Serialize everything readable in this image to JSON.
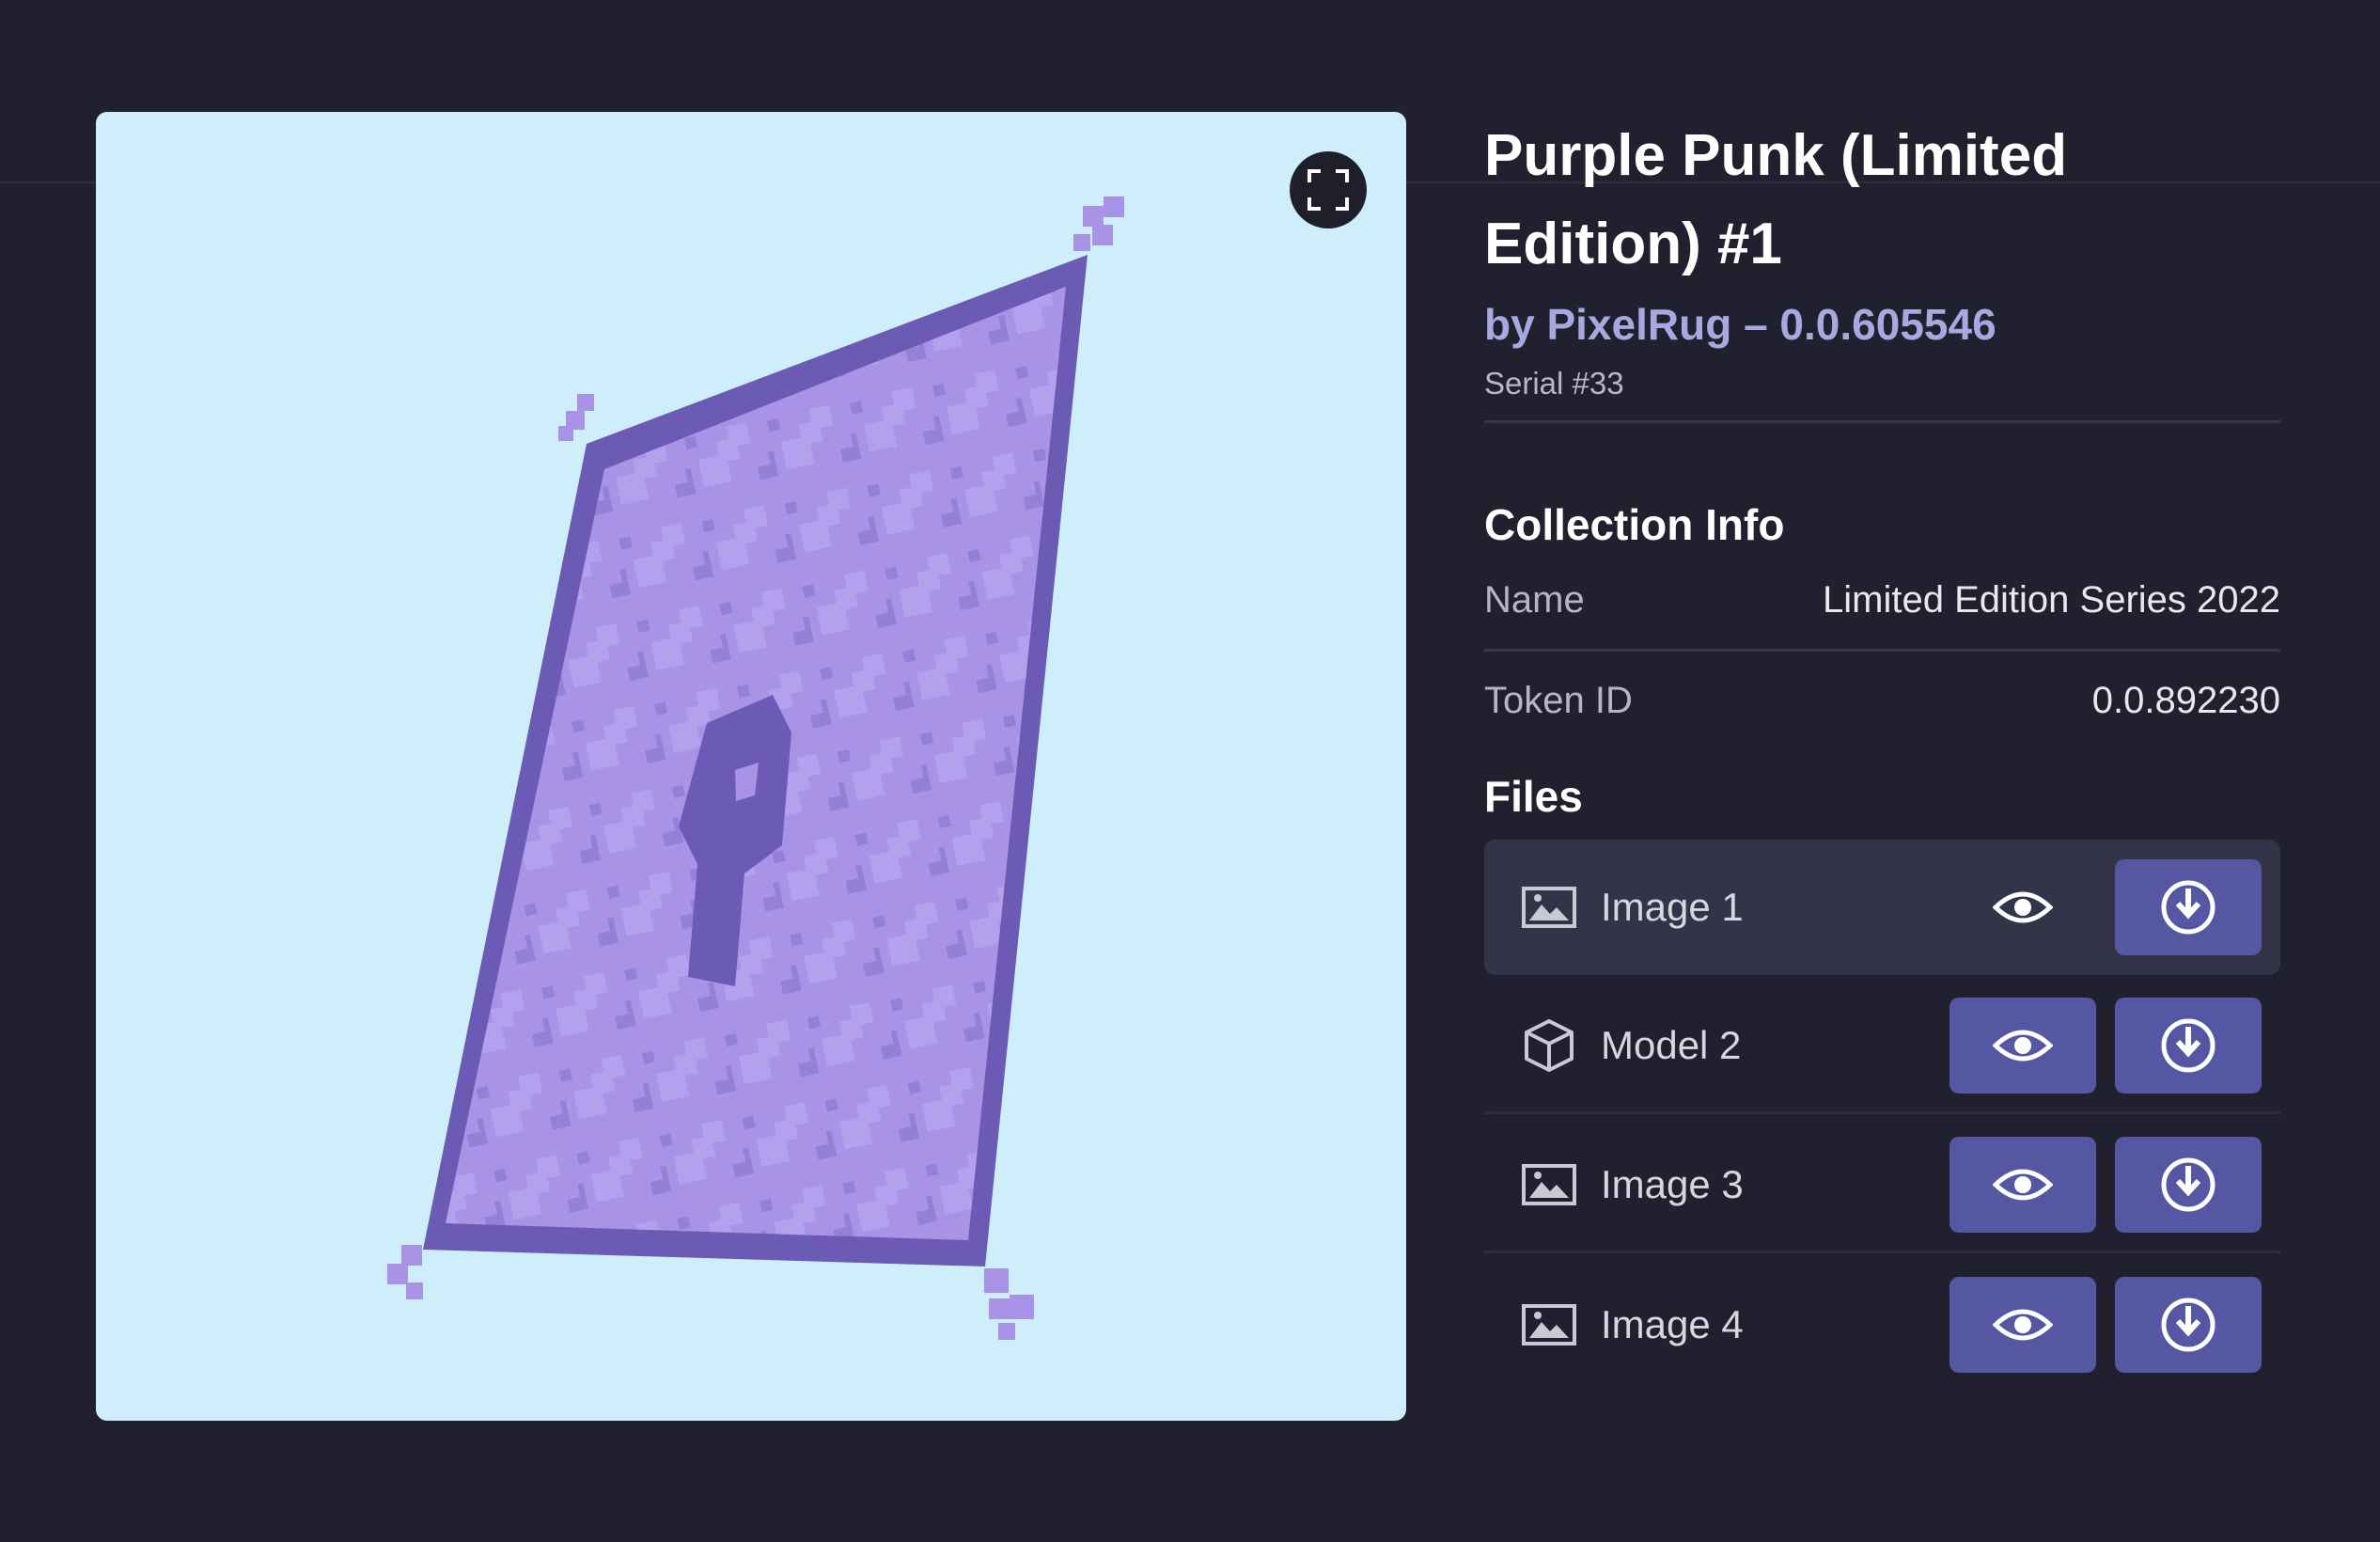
{
  "item": {
    "title": "Purple Punk (Limited Edition) #1",
    "byline": "by PixelRug – 0.0.605546",
    "serial": "Serial #33"
  },
  "collection": {
    "heading": "Collection Info",
    "rows": [
      {
        "label": "Name",
        "value": "Limited Edition Series 2022"
      },
      {
        "label": "Token ID",
        "value": "0.0.892230"
      }
    ]
  },
  "files": {
    "heading": "Files",
    "items": [
      {
        "name": "Image 1",
        "icon": "image-icon",
        "selected": true
      },
      {
        "name": "Model 2",
        "icon": "cube-icon",
        "selected": false
      },
      {
        "name": "Image 3",
        "icon": "image-icon",
        "selected": false
      },
      {
        "name": "Image 4",
        "icon": "image-icon",
        "selected": false
      }
    ]
  },
  "viewer": {
    "background": "#cfeefb",
    "icon": "fullscreen-icon"
  },
  "colors": {
    "page_background": "#20202e",
    "accent_button": "#5557a3",
    "rug_border": "#6b5bb5",
    "rug_fill": "#a993e6"
  }
}
